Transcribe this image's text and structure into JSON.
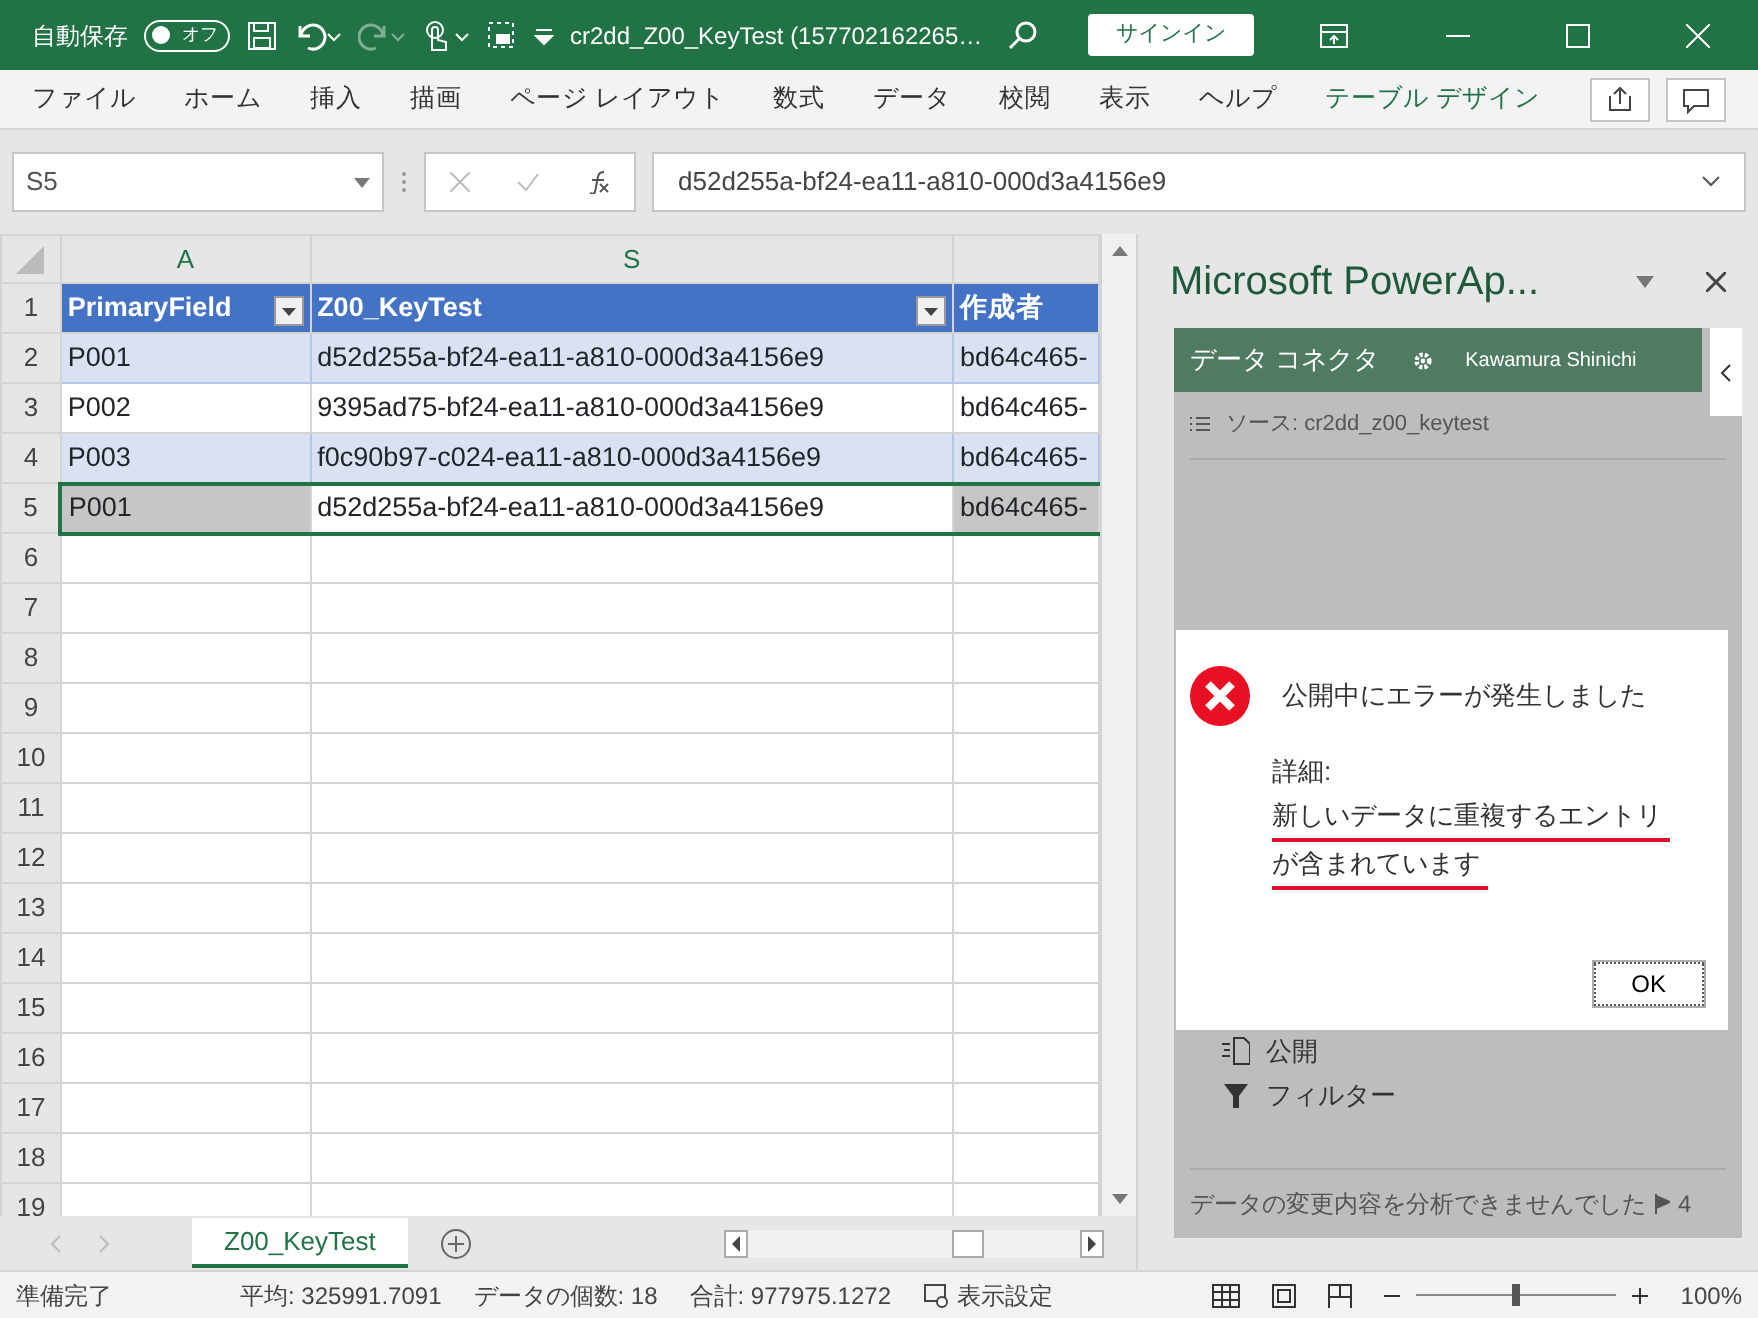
{
  "title_bar": {
    "autosave_label": "自動保存",
    "autosave_toggle": {
      "text": "オフ",
      "on": false
    },
    "document_title": "cr2dd_Z00_KeyTest (157702162265…",
    "sign_in": "サインイン"
  },
  "ribbon_tabs": [
    {
      "label": "ファイル",
      "kind": "normal"
    },
    {
      "label": "ホーム",
      "kind": "normal"
    },
    {
      "label": "挿入",
      "kind": "normal"
    },
    {
      "label": "描画",
      "kind": "normal"
    },
    {
      "label": "ページ レイアウト",
      "kind": "normal"
    },
    {
      "label": "数式",
      "kind": "normal"
    },
    {
      "label": "データ",
      "kind": "normal"
    },
    {
      "label": "校閲",
      "kind": "normal"
    },
    {
      "label": "表示",
      "kind": "normal"
    },
    {
      "label": "ヘルプ",
      "kind": "normal"
    },
    {
      "label": "テーブル デザイン",
      "kind": "contextual"
    }
  ],
  "formula_bar": {
    "name_box": "S5",
    "formula": "d52d255a-bf24-ea11-a810-000d3a4156e9"
  },
  "sheet": {
    "columns": [
      {
        "label": "A"
      },
      {
        "label": "S"
      }
    ],
    "header_row": {
      "number": "1",
      "cells": [
        {
          "text": "PrimaryField",
          "filter": true
        },
        {
          "text": "Z00_KeyTest",
          "filter": true
        },
        {
          "text": "作成者",
          "filter": false
        }
      ]
    },
    "rows": [
      {
        "number": "2",
        "banded": true,
        "selected": false,
        "cells": [
          "P001",
          "d52d255a-bf24-ea11-a810-000d3a4156e9",
          "bd64c465-"
        ]
      },
      {
        "number": "3",
        "banded": false,
        "selected": false,
        "cells": [
          "P002",
          "9395ad75-bf24-ea11-a810-000d3a4156e9",
          "bd64c465-"
        ]
      },
      {
        "number": "4",
        "banded": true,
        "selected": false,
        "cells": [
          "P003",
          "f0c90b97-c024-ea11-a810-000d3a4156e9",
          "bd64c465-"
        ]
      },
      {
        "number": "5",
        "banded": false,
        "selected": true,
        "cells": [
          "P001",
          "d52d255a-bf24-ea11-a810-000d3a4156e9",
          "bd64c465-"
        ]
      }
    ],
    "empty_rows": [
      "6",
      "7",
      "8",
      "9",
      "10",
      "11",
      "12",
      "13",
      "14",
      "15",
      "16",
      "17",
      "18",
      "19"
    ]
  },
  "sheet_tabs": [
    {
      "label": "Z00_KeyTest",
      "selected": true
    }
  ],
  "task_pane": {
    "title": "Microsoft PowerAp...",
    "header": "データ コネクタ",
    "user": "Kawamura Shinichi",
    "source": "ソース: cr2dd_z00_keytest",
    "actions": [
      {
        "label": "公開",
        "kind": "publish"
      },
      {
        "label": "フィルター",
        "kind": "filter"
      }
    ],
    "footer_message": "データの変更内容を分析できませんでした",
    "footer_count": "4"
  },
  "dialog": {
    "title": "公開中にエラーが発生しました",
    "details_label": "詳細:",
    "message_lines": [
      {
        "text": "新しいデータに重複するエントリ",
        "underlined": true
      },
      {
        "text": "が含まれています",
        "underlined": true
      }
    ],
    "button": "OK"
  },
  "status_bar": {
    "state": "準備完了",
    "average": "平均: 325991.7091",
    "count": "データの個数: 18",
    "sum": "合計: 977975.1272",
    "display_settings": "表示設定",
    "zoom": {
      "level": 0.5,
      "text": "100%"
    }
  }
}
